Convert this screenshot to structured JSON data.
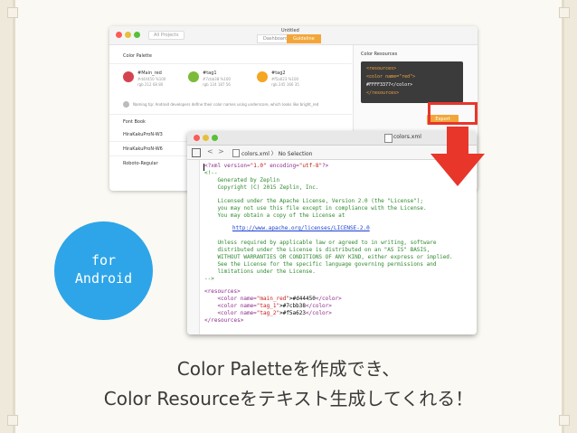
{
  "zeplin": {
    "all_projects": "All Projects",
    "window_title": "Untitled",
    "tabs": [
      "Dashboard",
      "Guideline"
    ],
    "color_palette_title": "Color Palette",
    "swatches": [
      {
        "name": "#Main_red",
        "hex": "#d44450 %100",
        "rgb": "rgb 212 68 80",
        "color": "#d44450"
      },
      {
        "name": "#tag1",
        "hex": "#7cbb38 %100",
        "rgb": "rgb 124 187 56",
        "color": "#7cbb38"
      },
      {
        "name": "#tag2",
        "hex": "#f5a623 %100",
        "rgb": "rgb 245 166 35",
        "color": "#f5a623"
      }
    ],
    "naming_tip": "Naming tip: Android developers define their color names using underscore, which looks like bright_red",
    "font_book_title": "Font Book",
    "fonts": [
      "HiraKakuProN-W3",
      "HiraKakuProN-W6",
      "Roboto-Regular"
    ],
    "color_resources_title": "Color Resources",
    "code_lines": [
      "<resources>",
      "  <color name=\"red\">",
      "    #FFFF3377</color>",
      "</resources>"
    ],
    "export_label": "Export"
  },
  "xcode": {
    "file_title": "colors.xml",
    "breadcrumb_file": "colors.xml",
    "breadcrumb_sep": "〉",
    "breadcrumb_sel": "No Selection",
    "nav_back": "<",
    "nav_fwd": ">",
    "lines": {
      "l1_a": "<?xml version=",
      "l1_b": "\"1.0\"",
      "l1_c": " encoding=",
      "l1_d": "\"utf-8\"",
      "l1_e": "?>",
      "l2": "<!--",
      "l3": "    Generated by Zeplin",
      "l4": "    Copyright (C) 2015 Zeplin, Inc.",
      "l5": "    Licensed under the Apache License, Version 2.0 (the \"License\");",
      "l6": "    you may not use this file except in compliance with the License.",
      "l7": "    You may obtain a copy of the License at",
      "l8": "http://www.apache.org/licenses/LICENSE-2.0",
      "l9": "    Unless required by applicable law or agreed to in writing, software",
      "l10": "    distributed under the License is distributed on an \"AS IS\" BASIS,",
      "l11": "    WITHOUT WARRANTIES OR CONDITIONS OF ANY KIND, either express or implied.",
      "l12": "    See the License for the specific language governing permissions and",
      "l13": "    limitations under the License.",
      "l14": "-->",
      "l15": "<resources>",
      "c1_open": "    <color name=",
      "c1_name": "\"main_red\"",
      "c1_val": ">#d44450",
      "c1_close": "</color>",
      "c2_open": "    <color name=",
      "c2_name": "\"tag_1\"",
      "c2_val": ">#7cbb38",
      "c2_close": "</color>",
      "c3_open": "    <color name=",
      "c3_name": "\"tag_2\"",
      "c3_val": ">#f5a623",
      "c3_close": "</color>",
      "l19": "</resources>"
    }
  },
  "badge": {
    "line1": "for",
    "line2": "Android",
    "color": "#2ea5e8"
  },
  "caption": {
    "line1": "Color Paletteを作成でき、",
    "line2": "Color Resourceをテキスト生成してくれる！"
  },
  "accent_colors": {
    "highlight": "#e8362b",
    "zeplin_orange": "#f2a63a"
  }
}
